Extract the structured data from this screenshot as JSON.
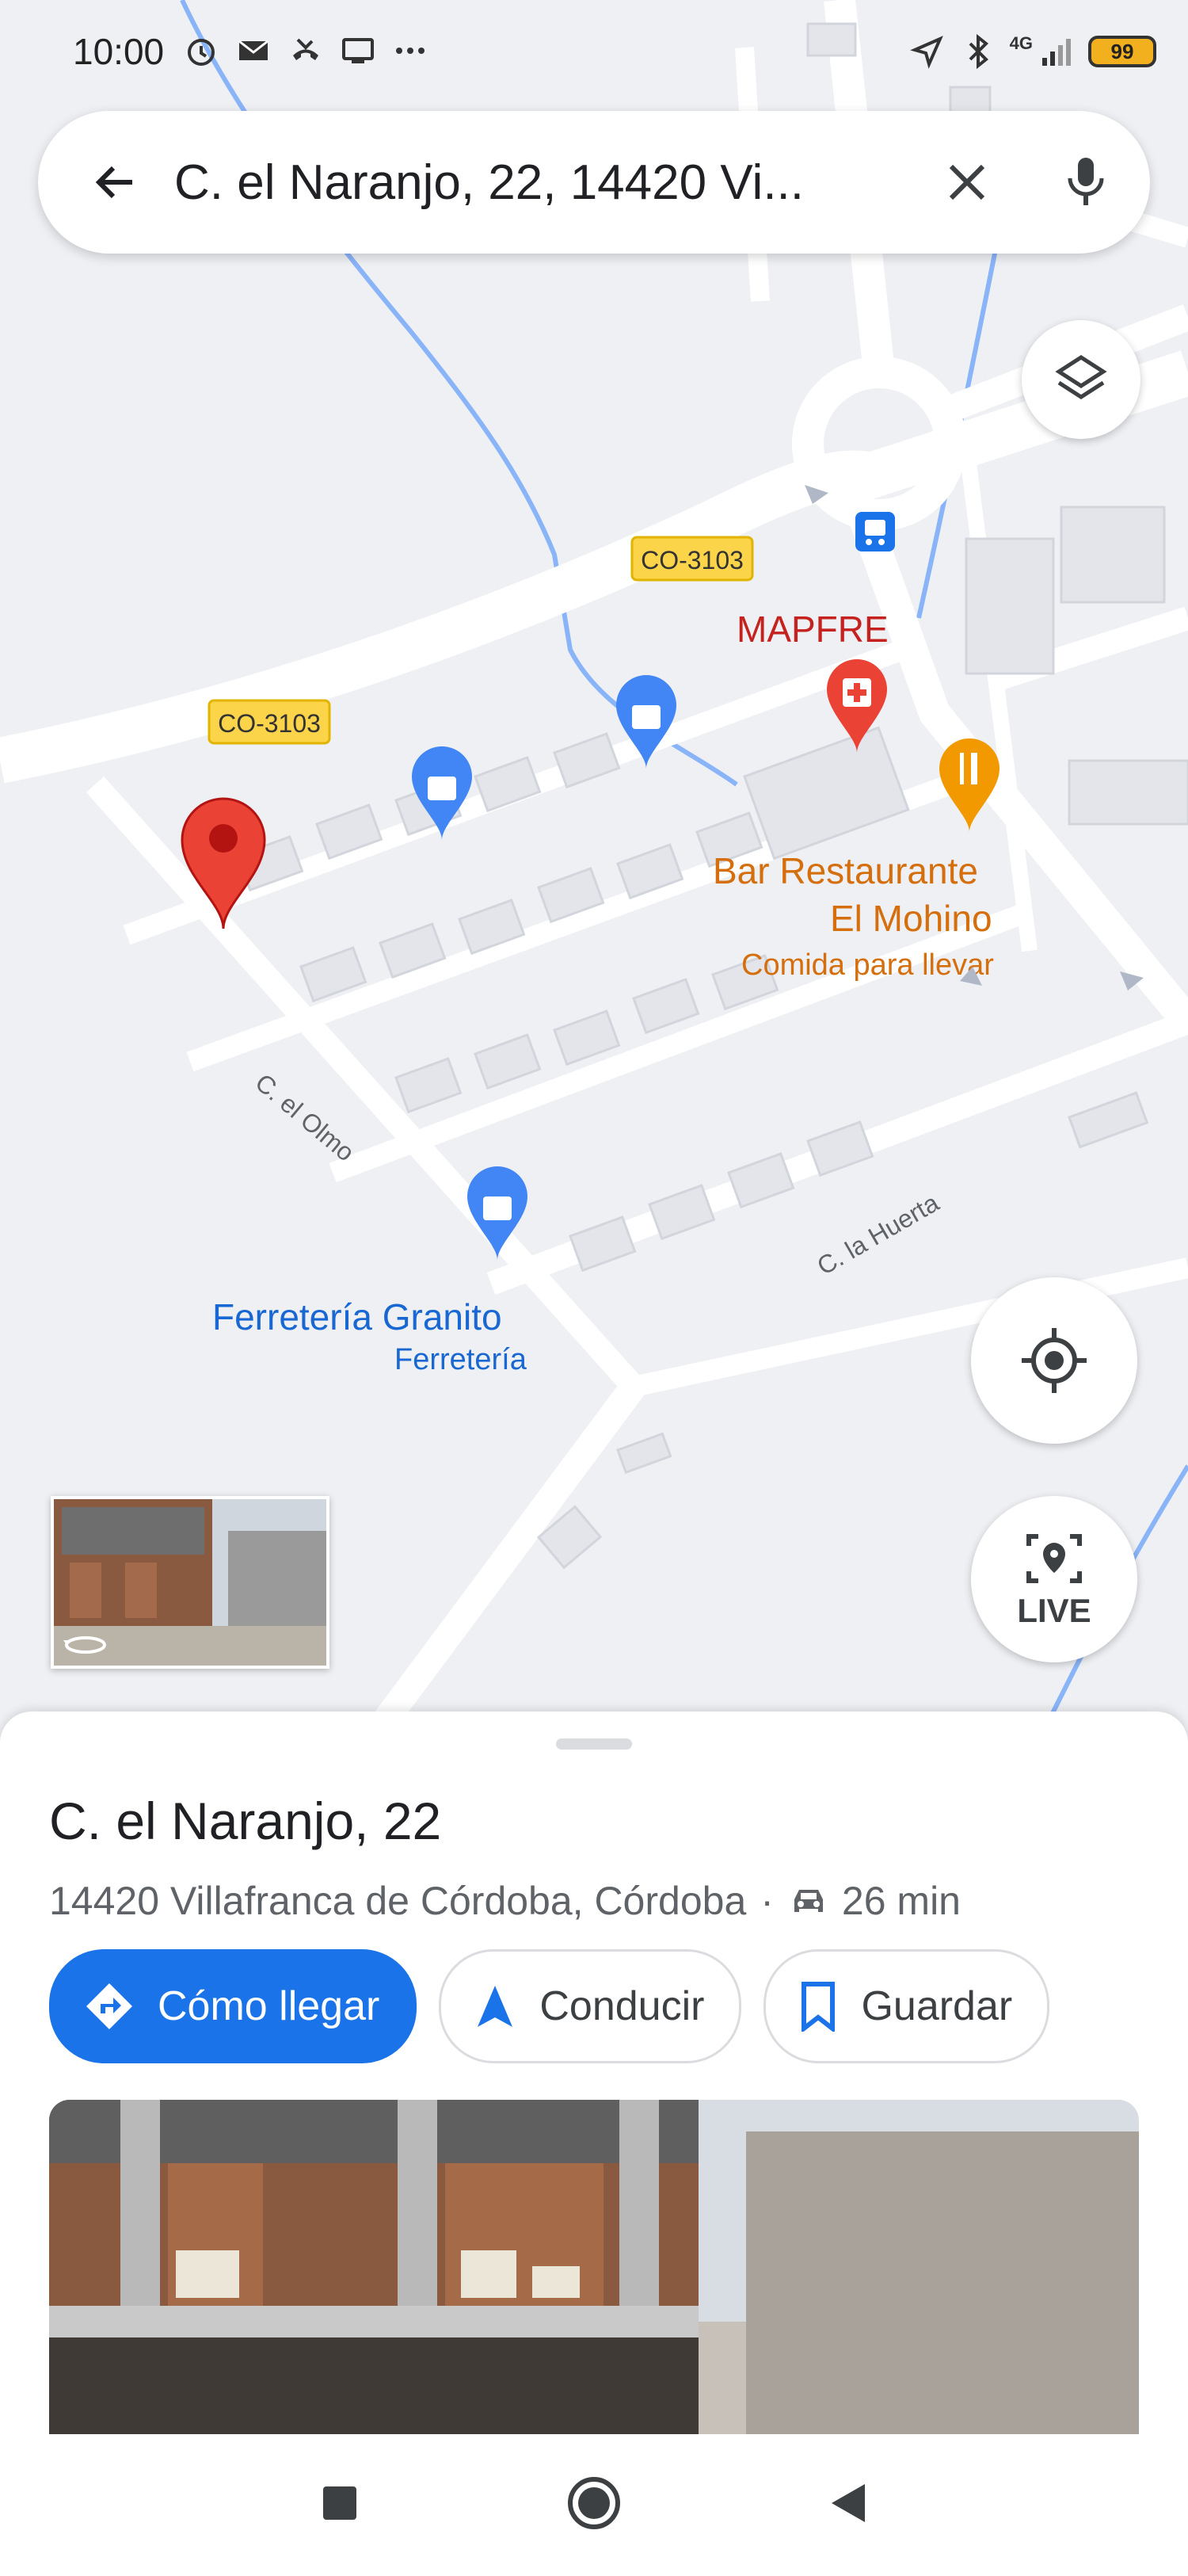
{
  "status_bar": {
    "time": "10:00",
    "icons_left": [
      "alarm-icon",
      "mail-icon",
      "missed-call-icon",
      "cast-icon",
      "more-icon"
    ],
    "network": "4G",
    "battery": "99"
  },
  "search": {
    "query": "C. el Naranjo, 22, 14420 Vi..."
  },
  "map": {
    "road_labels": [
      "CO-3103",
      "CO-3103"
    ],
    "street_labels": [
      "C. el Olmo",
      "C. la Huerta"
    ],
    "poi": {
      "mapfre": "MAPFRE",
      "bar_name_1": "Bar Restaurante",
      "bar_name_2": "El Mohino",
      "bar_sub": "Comida para llevar",
      "ferreteria_name": "Ferretería Granito",
      "ferreteria_sub": "Ferretería"
    },
    "live_label": "LIVE"
  },
  "place": {
    "title": "C. el Naranjo, 22",
    "address": "14420 Villafranca de Córdoba, Córdoba",
    "separator": "·",
    "drive_time": "26 min"
  },
  "actions": {
    "directions": "Cómo llegar",
    "drive": "Conducir",
    "save": "Guardar"
  },
  "colors": {
    "accent": "#1a73e8",
    "pin": "#ea4335",
    "poi_blue": "#4285f4",
    "poi_orange": "#f29900",
    "poi_red": "#ea4335",
    "road_label_bg": "#fbd44a"
  }
}
